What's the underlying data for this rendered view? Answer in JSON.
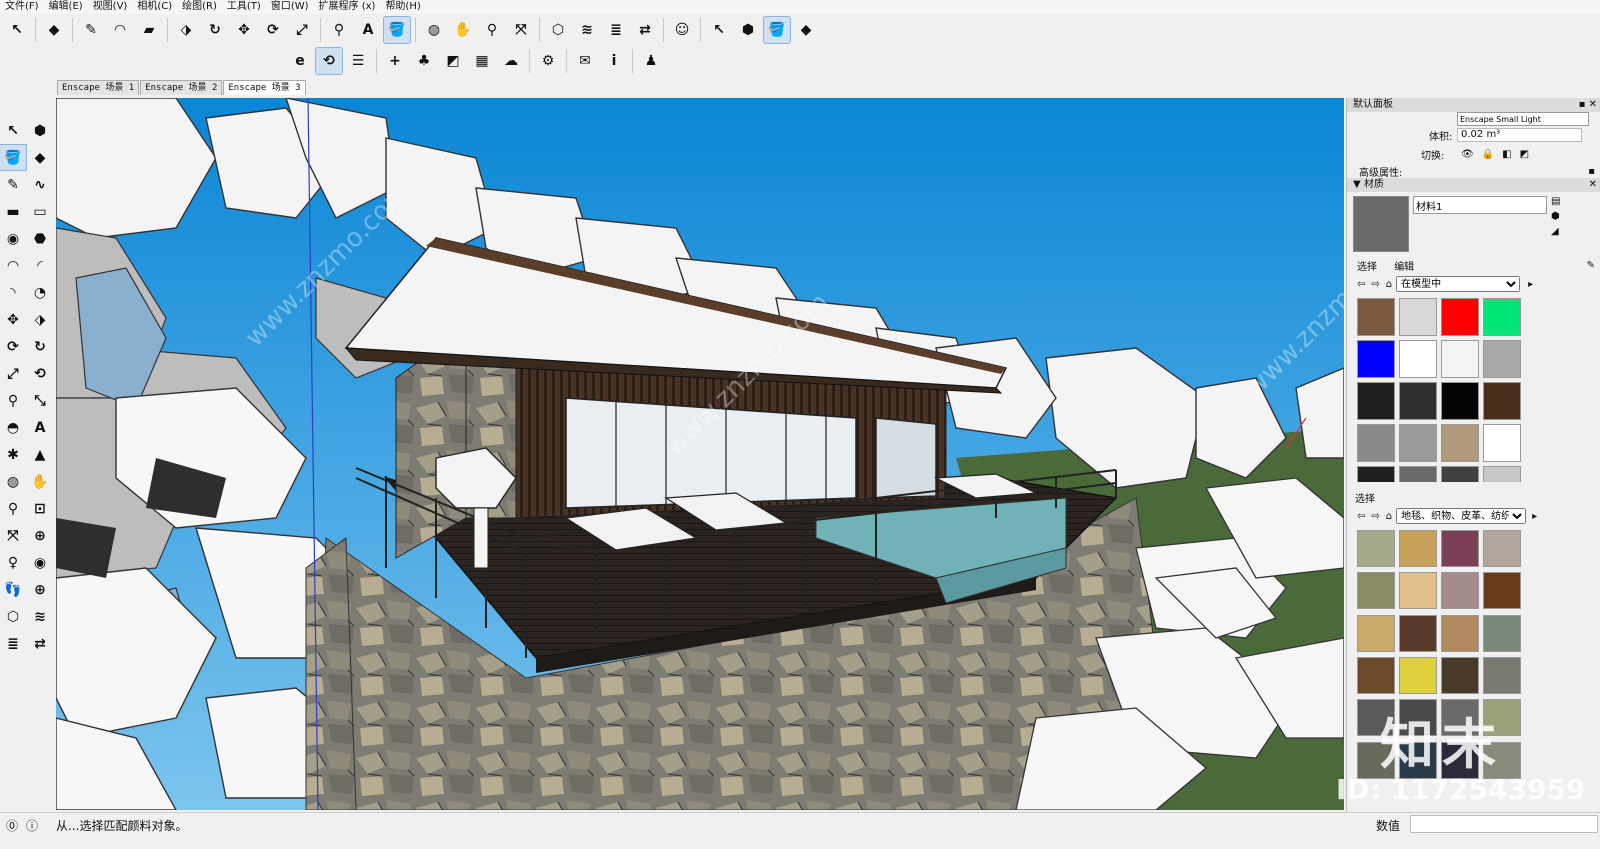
{
  "menu": [
    "文件(F)",
    "编辑(E)",
    "视图(V)",
    "相机(C)",
    "绘图(R)",
    "工具(T)",
    "窗口(W)",
    "扩展程序 (x)",
    "帮助(H)"
  ],
  "toolbar1": [
    {
      "name": "select-icon",
      "glyph": "↖"
    },
    {
      "name": "eraser-icon",
      "glyph": "◆"
    },
    {
      "name": "pencil-icon",
      "glyph": "✎"
    },
    {
      "name": "arc-icon",
      "glyph": "◠"
    },
    {
      "name": "rectangle-icon",
      "glyph": "▰"
    },
    {
      "name": "push-pull-icon",
      "glyph": "⬗"
    },
    {
      "name": "follow-me-icon",
      "glyph": "↻"
    },
    {
      "name": "move-icon",
      "glyph": "✥"
    },
    {
      "name": "rotate-icon",
      "glyph": "⟳"
    },
    {
      "name": "scale-icon",
      "glyph": "⤢"
    },
    {
      "name": "tape-measure-icon",
      "glyph": "⚲"
    },
    {
      "name": "text-icon",
      "glyph": "A"
    },
    {
      "name": "paint-bucket-icon",
      "glyph": "🪣"
    },
    {
      "name": "orbit-icon",
      "glyph": "◍"
    },
    {
      "name": "pan-icon",
      "glyph": "✋"
    },
    {
      "name": "zoom-icon",
      "glyph": "⚲"
    },
    {
      "name": "zoom-extents-icon",
      "glyph": "⤧"
    },
    {
      "name": "warehouse-icon",
      "glyph": "⬡"
    },
    {
      "name": "extension-warehouse-icon",
      "glyph": "≋"
    },
    {
      "name": "layers-icon",
      "glyph": "≣"
    },
    {
      "name": "share-model-icon",
      "glyph": "⇄"
    },
    {
      "name": "account-icon",
      "glyph": "☺"
    },
    {
      "name": "select-small-icon",
      "glyph": "↖"
    },
    {
      "name": "component-icon",
      "glyph": "⬢"
    },
    {
      "name": "paint-small-icon",
      "glyph": "🪣"
    },
    {
      "name": "eraser-small-icon",
      "glyph": "◆"
    }
  ],
  "toolbar2": [
    {
      "name": "enscape-start-icon",
      "glyph": "e"
    },
    {
      "name": "enscape-sync-icon",
      "glyph": "⟲"
    },
    {
      "name": "enscape-views-icon",
      "glyph": "☰"
    },
    {
      "name": "enscape-add-icon",
      "glyph": "+"
    },
    {
      "name": "enscape-asset-icon",
      "glyph": "♣"
    },
    {
      "name": "enscape-material-icon",
      "glyph": "◩"
    },
    {
      "name": "enscape-texture-icon",
      "glyph": "▦"
    },
    {
      "name": "enscape-upload-icon",
      "glyph": "☁"
    },
    {
      "name": "enscape-settings-icon",
      "glyph": "⚙"
    },
    {
      "name": "enscape-feedback-icon",
      "glyph": "✉"
    },
    {
      "name": "enscape-info-icon",
      "glyph": "i"
    },
    {
      "name": "enscape-account-icon",
      "glyph": "♟"
    }
  ],
  "tabs": [
    "Enscape 场景 1",
    "Enscape 场景 2",
    "Enscape 场景 3"
  ],
  "left_tools": [
    {
      "name": "select-icon",
      "glyph": "↖"
    },
    {
      "name": "component-icon",
      "glyph": "⬢"
    },
    {
      "name": "paint-bucket-icon",
      "glyph": "🪣"
    },
    {
      "name": "eraser-icon",
      "glyph": "◆"
    },
    {
      "name": "pencil-icon",
      "glyph": "✎"
    },
    {
      "name": "freehand-icon",
      "glyph": "∿"
    },
    {
      "name": "rectangle-icon",
      "glyph": "▬"
    },
    {
      "name": "rotated-rectangle-icon",
      "glyph": "▭"
    },
    {
      "name": "circle-icon",
      "glyph": "◉"
    },
    {
      "name": "polygon-icon",
      "glyph": "⬣"
    },
    {
      "name": "arc-icon",
      "glyph": "◠"
    },
    {
      "name": "two-point-arc-icon",
      "glyph": "◜"
    },
    {
      "name": "three-point-arc-icon",
      "glyph": "◝"
    },
    {
      "name": "pie-icon",
      "glyph": "◔"
    },
    {
      "name": "move-icon",
      "glyph": "✥"
    },
    {
      "name": "push-pull-icon",
      "glyph": "⬗"
    },
    {
      "name": "rotate-icon",
      "glyph": "⟳"
    },
    {
      "name": "follow-me-icon",
      "glyph": "↻"
    },
    {
      "name": "scale-icon",
      "glyph": "⤢"
    },
    {
      "name": "offset-icon",
      "glyph": "⟲"
    },
    {
      "name": "tape-measure-icon",
      "glyph": "⚲"
    },
    {
      "name": "dimension-icon",
      "glyph": "⤡"
    },
    {
      "name": "protractor-icon",
      "glyph": "◓"
    },
    {
      "name": "text-icon",
      "glyph": "A"
    },
    {
      "name": "axes-icon",
      "glyph": "✱"
    },
    {
      "name": "3d-text-icon",
      "glyph": "▲"
    },
    {
      "name": "orbit-icon",
      "glyph": "◍"
    },
    {
      "name": "pan-icon",
      "glyph": "✋"
    },
    {
      "name": "zoom-icon",
      "glyph": "⚲"
    },
    {
      "name": "zoom-window-icon",
      "glyph": "⊡"
    },
    {
      "name": "zoom-extents-icon",
      "glyph": "⤧"
    },
    {
      "name": "previous-view-icon",
      "glyph": "⊕"
    },
    {
      "name": "position-camera-icon",
      "glyph": "♀"
    },
    {
      "name": "look-around-icon",
      "glyph": "◉"
    },
    {
      "name": "walk-icon",
      "glyph": "👣"
    },
    {
      "name": "section-plane-icon",
      "glyph": "⊕"
    },
    {
      "name": "warehouse-icon",
      "glyph": "⬡"
    },
    {
      "name": "extension-icon",
      "glyph": "≋"
    },
    {
      "name": "layers-icon",
      "glyph": "≣"
    },
    {
      "name": "share-icon",
      "glyph": "⇄"
    }
  ],
  "panel": {
    "title": "默认面板",
    "definition_value": "Enscape Small Light",
    "volume_label": "体积:",
    "volume_value": "0.02 m³",
    "toggle_label": "切换:",
    "advanced_label": "高级属性:",
    "materials_title": "▼ 材质",
    "material_name": "材料1",
    "tab_select": "选择",
    "tab_edit": "编辑",
    "library_value": "在模型中",
    "library_options": [
      "在模型中"
    ],
    "select2_label": "选择",
    "library2_value": "地毯、织物、皮革、纺织品",
    "library2_options": [
      "地毯、织物、皮革、纺织品"
    ],
    "swatches_in_model": [
      "#7a5a3c",
      "#d8d8d8",
      "#ff0000",
      "#00e676",
      "#0000ff",
      "#ffffff",
      "#f4f4f4",
      "#a8a8a8",
      "#1f1f1f",
      "#303030",
      "#050505",
      "#4a2e1c",
      "#8a8a8a",
      "#9a9a9a",
      "#b09a7a",
      "#ffffff",
      "#202020",
      "#6a6a6a",
      "#404040",
      "#c8c8c8"
    ],
    "swatches_library": [
      "#a7a98b",
      "#c8a25a",
      "#7a3e57",
      "#b3a59a",
      "#8a8a64",
      "#e2bf8a",
      "#a58b8a",
      "#6a3a1a",
      "#caa96a",
      "#5a3a2a",
      "#b08860",
      "#7a8a7a",
      "#6a4a2a",
      "#e0d040",
      "#4a3a2a",
      "#7a7a72",
      "#5a5a5a",
      "#4a4a4a",
      "#6a6a6a",
      "#9aa07a",
      "#6a6a5a",
      "#2a3a4a",
      "#2a2a3a",
      "#8a8a7a"
    ]
  },
  "status": {
    "text": "从...选择匹配颜料对象。",
    "measure_label": "数值"
  },
  "watermark": {
    "brand": "知末",
    "id": "ID: 1172543959",
    "url": "www.znzmo.com"
  }
}
